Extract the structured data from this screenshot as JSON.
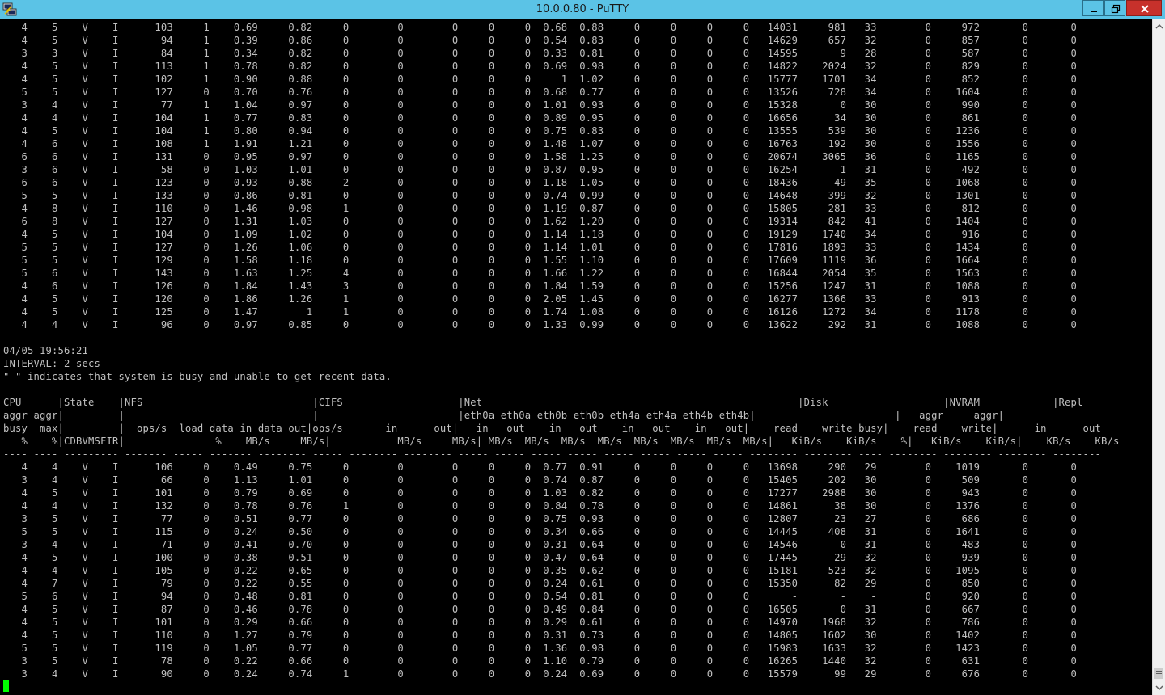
{
  "window": {
    "title": "10.0.0.80 - PuTTY",
    "titlebar_color": "#5bc3e6",
    "icon": "putty-icon",
    "controls": [
      "minimize-icon",
      "restore-icon",
      "close-icon"
    ]
  },
  "terminal": {
    "background": "#000000",
    "text_color": "#c0c0c0",
    "cursor_color": "#00ff00",
    "lines": [
      "   4    5    V    I      103     1    0.69     0.82     0        0        0     0     0  0.68  0.88     0     0     0     0   14031     981   33        0     972       0       0",
      "   4    5    V    I       94     1    0.39     0.86     0        0        0     0     0  0.54  0.83     0     0     0     0   14629     657   32        0     857       0       0",
      "   3    3    V    I       84     1    0.34     0.82     0        0        0     0     0  0.33  0.81     0     0     0     0   14595       9   28        0     587       0       0",
      "   4    5    V    I      113     1    0.78     0.82     0        0        0     0     0  0.69  0.98     0     0     0     0   14822    2024   32        0     829       0       0",
      "   4    5    V    I      102     1    0.90     0.88     0        0        0     0     0     1  1.02     0     0     0     0   15777    1701   34        0     852       0       0",
      "   5    5    V    I      127     0    0.70     0.76     0        0        0     0     0  0.68  0.77     0     0     0     0   13526     728   34        0    1604       0       0",
      "   3    4    V    I       77     1    1.04     0.97     0        0        0     0     0  1.01  0.93     0     0     0     0   15328       0   30        0     990       0       0",
      "   4    4    V    I      104     1    0.77     0.83     0        0        0     0     0  0.89  0.95     0     0     0     0   16656      34   30        0     861       0       0",
      "   4    5    V    I      104     1    0.80     0.94     0        0        0     0     0  0.75  0.83     0     0     0     0   13555     539   30        0    1236       0       0",
      "   4    6    V    I      108     1    1.91     1.21     0        0        0     0     0  1.48  1.07     0     0     0     0   16763     192   30        0    1556       0       0",
      "   6    6    V    I      131     0    0.95     0.97     0        0        0     0     0  1.58  1.25     0     0     0     0   20674    3065   36        0    1165       0       0",
      "   3    6    V    I       58     0    1.03     1.01     0        0        0     0     0  0.87  0.95     0     0     0     0   16254       1   31        0     492       0       0",
      "   6    6    V    I      123     0    0.93     0.88     2        0        0     0     0  1.18  1.05     0     0     0     0   18436      49   35        0    1068       0       0",
      "   5    5    V    I      133     0    0.86     0.81     0        0        0     0     0  0.74  0.99     0     0     0     0   14648     399   32        0    1301       0       0",
      "   4    8    V    I      110     0    1.46     0.98     1        0        0     0     0  1.19  0.87     0     0     0     0   15805     281   33        0     812       0       0",
      "   6    8    V    I      127     0    1.31     1.03     0        0        0     0     0  1.62  1.20     0     0     0     0   19314     842   41        0    1404       0       0",
      "   4    5    V    I      104     0    1.09     1.02     0        0        0     0     0  1.14  1.18     0     0     0     0   19129    1740   34        0     916       0       0",
      "   5    5    V    I      127     0    1.26     1.06     0        0        0     0     0  1.14  1.01     0     0     0     0   17816    1893   33        0    1434       0       0",
      "   5    5    V    I      129     0    1.58     1.18     0        0        0     0     0  1.55  1.10     0     0     0     0   17609    1119   36        0    1664       0       0",
      "   5    6    V    I      143     0    1.63     1.25     4        0        0     0     0  1.66  1.22     0     0     0     0   16844    2054   35        0    1563       0       0",
      "   4    6    V    I      126     0    1.84     1.43     3        0        0     0     0  1.84  1.59     0     0     0     0   15256    1247   31        0    1088       0       0",
      "   4    5    V    I      120     0    1.86     1.26     1        0        0     0     0  2.05  1.45     0     0     0     0   16277    1366   33        0     913       0       0",
      "   4    5    V    I      125     0    1.47        1     1        0        0     0     0  1.74  1.08     0     0     0     0   16126    1272   34        0    1178       0       0",
      "   4    4    V    I       96     0    0.97     0.85     0        0        0     0     0  1.33  0.99     0     0     0     0   13622     292   31        0    1088       0       0",
      "",
      "04/05 19:56:21",
      "INTERVAL: 2 secs",
      "\"-\" indicates that system is busy and unable to get recent data.",
      "--------------------------------------------------------------------------------------------------------------------------------------------------------------------------------------------",
      "CPU      |State    |NFS                            |CIFS                   |Net                                                    |Disk                   |NVRAM            |Repl",
      "aggr aggr|         |                               |                       |eth0a eth0a eth0b eth0b eth4a eth4a eth4b eth4b|                       |   aggr     aggr|",
      "busy  max|         |  ops/s  load data in data out|ops/s       in      out|   in   out    in   out    in   out    in   out|    read    write busy|    read    write|      in      out",
      "   %    %|CDBVMSFIR|               %    MB/s     MB/s|           MB/s     MB/s| MB/s  MB/s  MB/s  MB/s  MB/s  MB/s  MB/s  MB/s|   KiB/s    KiB/s    %|   KiB/s    KiB/s|    KB/s    KB/s",
      "---- ---- --------- ------- ----- ------- -------- ----- -------- -------- ----- ----- ----- ----- ----- ----- ----- ----- -------- -------- ---- -------- -------- -------- --------",
      "   4    4    V    I      106     0    0.49     0.75     0        0        0     0     0  0.77  0.91     0     0     0     0   13698     290   29        0    1019       0       0",
      "   3    4    V    I       66     0    1.13     1.01     0        0        0     0     0  0.74  0.87     0     0     0     0   15405     202   30        0     509       0       0",
      "   4    5    V    I      101     0    0.79     0.69     0        0        0     0     0  1.03  0.82     0     0     0     0   17277    2988   30        0     943       0       0",
      "   4    4    V    I      132     0    0.78     0.76     1        0        0     0     0  0.84  0.78     0     0     0     0   14861      38   30        0    1376       0       0",
      "   3    5    V    I       77     0    0.51     0.77     0        0        0     0     0  0.75  0.93     0     0     0     0   12807      23   27        0     686       0       0",
      "   5    5    V    I      115     0    0.24     0.50     0        0        0     0     0  0.34  0.66     0     0     0     0   14445     408   31        0    1641       0       0",
      "   3    4    V    I       71     0    0.41     0.70     0        0        0     0     0  0.31  0.64     0     0     0     0   14546       0   31        0     483       0       0",
      "   4    5    V    I      100     0    0.38     0.51     0        0        0     0     0  0.47  0.64     0     0     0     0   17445      29   32        0     939       0       0",
      "   4    4    V    I      105     0    0.22     0.65     0        0        0     0     0  0.35  0.62     0     0     0     0   15181     523   32        0    1095       0       0",
      "   4    7    V    I       79     0    0.22     0.55     0        0        0     0     0  0.24  0.61     0     0     0     0   15350      82   29        0     850       0       0",
      "   5    6    V    I       94     0    0.48     0.81     0        0        0     0     0  0.54  0.81     0     0     0     0       -       -    -        0     920       0       0",
      "   4    5    V    I       87     0    0.46     0.78     0        0        0     0     0  0.49  0.84     0     0     0     0   16505       0   31        0     667       0       0",
      "   4    5    V    I      101     0    0.29     0.66     0        0        0     0     0  0.29  0.61     0     0     0     0   14970    1968   32        0     786       0       0",
      "   4    5    V    I      110     0    1.27     0.79     0        0        0     0     0  0.31  0.73     0     0     0     0   14805    1602   30        0    1402       0       0",
      "   5    5    V    I      119     0    1.05     0.77     0        0        0     0     0  1.36  0.98     0     0     0     0   15983    1633   32        0    1423       0       0",
      "   3    5    V    I       78     0    0.22     0.66     0        0        0     0     0  1.10  0.79     0     0     0     0   16265    1440   32        0     631       0       0",
      "   3    4    V    I       90     0    0.24     0.74     1        0        0     0     0  0.24  0.69     0     0     0     0   15579      99   29        0     676       0       0"
    ]
  }
}
